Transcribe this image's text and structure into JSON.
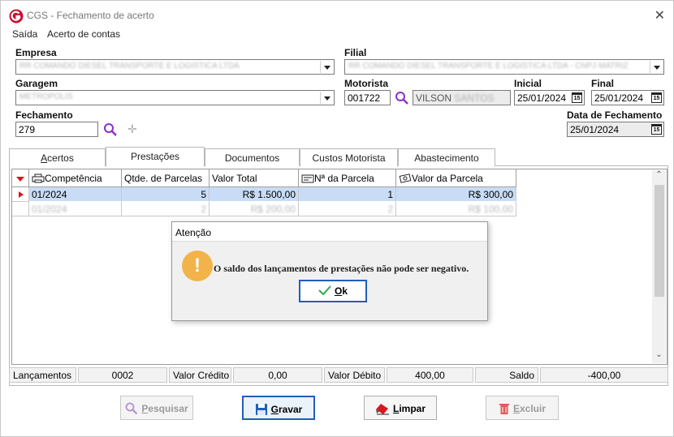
{
  "window": {
    "title": "CGS - Fechamento de acerto",
    "close_glyph": "✕"
  },
  "menu": [
    "Saída",
    "Acerto de contas"
  ],
  "form": {
    "empresa": {
      "label": "Empresa",
      "value": "RR COMANDO DIESEL TRANSPORTE E LOGISTICA LTDA"
    },
    "filial": {
      "label": "Filial",
      "value": "RR COMANDO DIESEL TRANSPORTE E LOGISTICA LTDA - CNPJ MATRIZ"
    },
    "garagem": {
      "label": "Garagem",
      "value": "METROPOLIS"
    },
    "motorista": {
      "label": "Motorista",
      "code": "001722",
      "name": "VILSON",
      "name_hidden": "SANTOS"
    },
    "inicial": {
      "label": "Inicial",
      "value": "25/01/2024"
    },
    "final": {
      "label": "Final",
      "value": "25/01/2024"
    },
    "fechamento": {
      "label": "Fechamento",
      "value": "279"
    },
    "data_fechamento": {
      "label": "Data de Fechamento",
      "value": "25/01/2024"
    }
  },
  "tabs": [
    {
      "label": "Acertos",
      "underline": "A",
      "rest": "certos"
    },
    {
      "label": "Prestações",
      "underline": "",
      "rest": "Prestações"
    },
    {
      "label": "Documentos",
      "underline": "",
      "rest": "Documentos"
    },
    {
      "label": "Custos Motorista",
      "underline": "",
      "rest": "Custos Motorista"
    },
    {
      "label": "Abastecimento",
      "underline": "",
      "rest": "Abastecimento"
    }
  ],
  "grid": {
    "columns": [
      "Competência",
      "Qtde. de Parcelas",
      "Valor Total",
      "Nª da Parcela",
      "Valor da Parcela"
    ],
    "rows": [
      [
        "01/2024",
        "5",
        "R$ 1.500,00",
        "1",
        "R$ 300,00"
      ],
      [
        "01/2024",
        "2",
        "R$ 200,00",
        "2",
        "R$ 100,00"
      ]
    ]
  },
  "summary": {
    "lancamentos_label": "Lançamentos",
    "lancamentos_value": "0002",
    "credito_label": "Valor Crédito",
    "credito_value": "0,00",
    "debito_label": "Valor Débito",
    "debito_value": "400,00",
    "saldo_label": "Saldo",
    "saldo_value": "-400,00"
  },
  "buttons": {
    "pesquisar": {
      "u": "P",
      "rest": "esquisar"
    },
    "gravar": {
      "u": "G",
      "rest": "ravar"
    },
    "limpar": {
      "u": "L",
      "rest": "impar"
    },
    "excluir": {
      "u": "E",
      "rest": "xcluir"
    }
  },
  "dialog": {
    "title": "Atenção",
    "icon": "!",
    "message": "O saldo dos lançamentos de prestações não pode ser negativo.",
    "ok_u": "O",
    "ok_rest": "k"
  },
  "colors": {
    "accent": "#1f5fb8",
    "warning": "#f2b34a",
    "selected_row": "#c9dcf5",
    "search_icon": "#8b2fc9"
  }
}
